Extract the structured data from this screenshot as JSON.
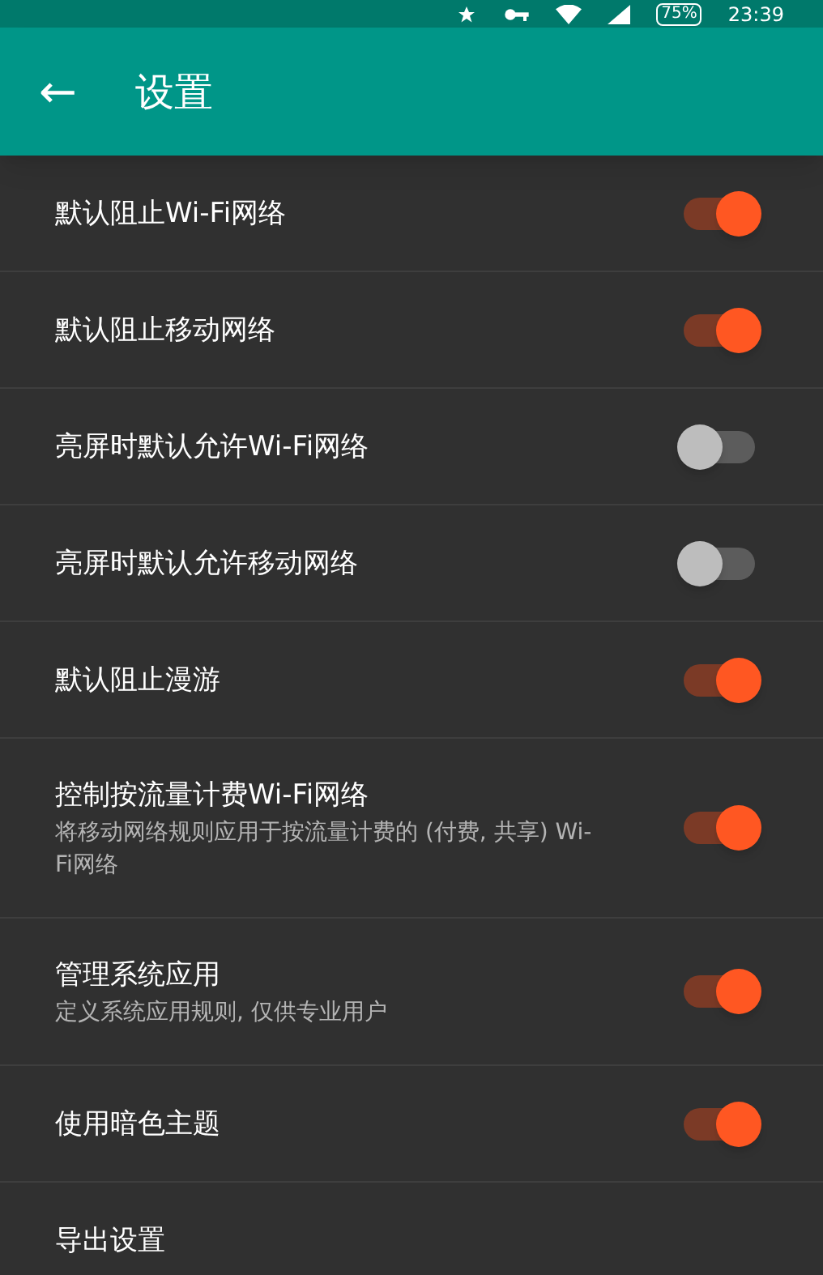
{
  "status_bar": {
    "battery": "75%",
    "time": "23:39"
  },
  "app_bar": {
    "back": "←",
    "title": "设置"
  },
  "settings": [
    {
      "title": "默认阻止Wi-Fi网络",
      "on": true
    },
    {
      "title": "默认阻止移动网络",
      "on": true
    },
    {
      "title": "亮屏时默认允许Wi-Fi网络",
      "on": false
    },
    {
      "title": "亮屏时默认允许移动网络",
      "on": false
    },
    {
      "title": "默认阻止漫游",
      "on": true
    },
    {
      "title": "控制按流量计费Wi-Fi网络",
      "subtitle": "将移动网络规则应用于按流量计费的 (付费, 共享) Wi-Fi网络",
      "on": true
    },
    {
      "title": "管理系统应用",
      "subtitle": "定义系统应用规则, 仅供专业用户",
      "on": true
    },
    {
      "title": "使用暗色主题",
      "on": true
    },
    {
      "title": "导出设置"
    }
  ]
}
